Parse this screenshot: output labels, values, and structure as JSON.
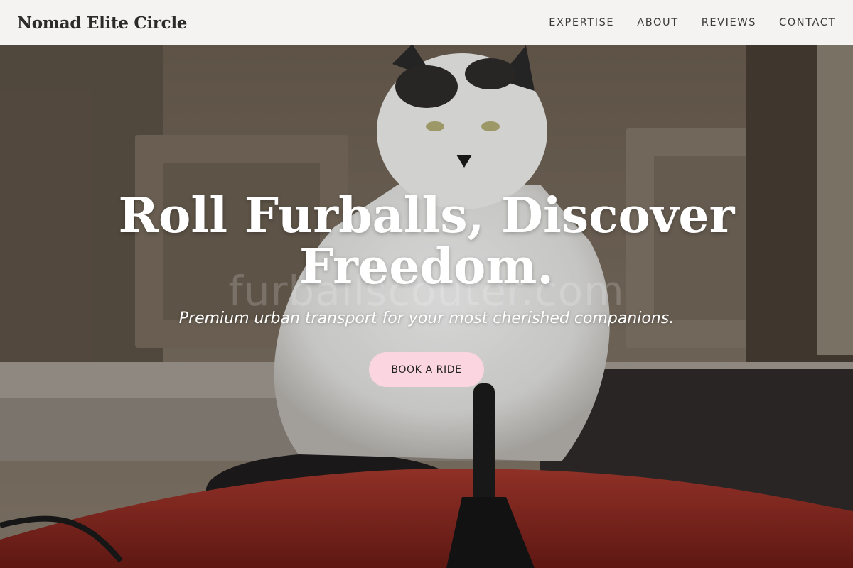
{
  "header": {
    "brand": "Nomad Elite Circle",
    "nav": [
      {
        "label": "EXPERTISE"
      },
      {
        "label": "ABOUT"
      },
      {
        "label": "REVIEWS"
      },
      {
        "label": "CONTACT"
      }
    ]
  },
  "hero": {
    "headline": "Roll Furballs, Discover Freedom.",
    "watermark": "furballscouter.com",
    "subtitle": "Premium urban transport for your most cherished companions.",
    "cta_label": "BOOK A RIDE"
  },
  "colors": {
    "header_bg": "#faf9f7",
    "cta_bg": "#fbd5df",
    "headline": "#ffffff"
  }
}
